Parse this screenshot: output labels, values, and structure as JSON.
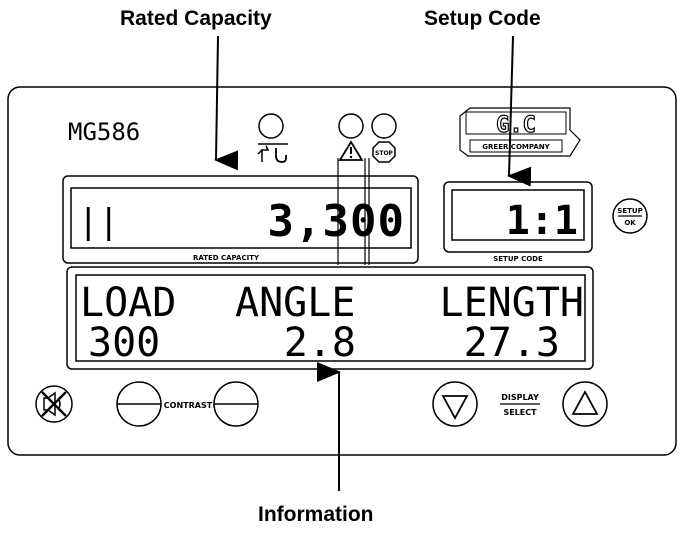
{
  "callouts": {
    "rated_capacity": "Rated Capacity",
    "setup_code": "Setup Code",
    "information": "Information"
  },
  "panel": {
    "model": "MG586",
    "logo_letters": "G.C",
    "logo_text": "GREER COMPANY",
    "stop_text": "STOP"
  },
  "rated_display": {
    "indicator": "||",
    "value": "3,300",
    "caption": "RATED CAPACITY"
  },
  "setup_display": {
    "value": "1:1",
    "caption": "SETUP CODE"
  },
  "setup_button": {
    "top": "SETUP",
    "bottom": "OK"
  },
  "info_display": {
    "headers": [
      "LOAD",
      "ANGLE",
      "LENGTH"
    ],
    "values": [
      "300",
      "2.8",
      "27.3"
    ]
  },
  "controls": {
    "contrast_label": "CONTRAST",
    "display_label": "DISPLAY",
    "select_label": "SELECT"
  },
  "icons": [
    "crane-hook-icon",
    "warning-triangle-icon",
    "stop-sign-icon",
    "alarm-mute-icon",
    "minus-circle-icon",
    "half-circle-icon",
    "down-triangle-icon",
    "up-triangle-icon"
  ]
}
